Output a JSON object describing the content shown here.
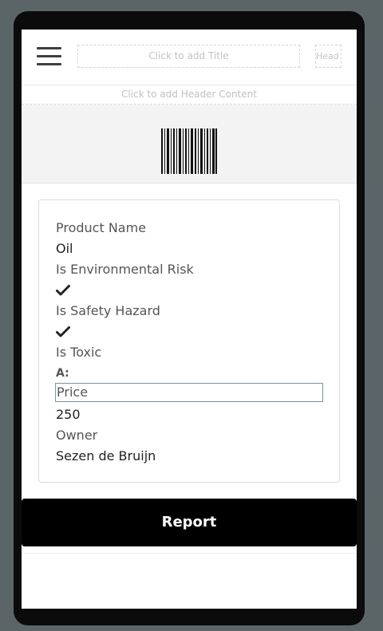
{
  "header": {
    "title_placeholder": "Click to add Title",
    "right_placeholder": "Head",
    "header_content_placeholder": "Click to add Header Content"
  },
  "icons": {
    "menu": "hamburger-icon",
    "barcode": "barcode-icon",
    "check": "checkmark-icon",
    "edit": "format-text-icon"
  },
  "details": {
    "product_name_label": "Product Name",
    "product_name_value": "Oil",
    "env_risk_label": "Is Environmental Risk",
    "env_risk_value": true,
    "safety_label": "Is Safety Hazard",
    "safety_value": true,
    "toxic_label": "Is Toxic",
    "toxic_edit_glyph": "A:",
    "price_label": "Price",
    "price_value": "250",
    "owner_label": "Owner",
    "owner_value": "Sezen de Bruijn"
  },
  "actions": {
    "report_label": "Report"
  },
  "colors": {
    "frame": "#0b0b0b",
    "backdrop": "#5b6567",
    "button": "#000000",
    "focus_border": "#7d91a8"
  }
}
